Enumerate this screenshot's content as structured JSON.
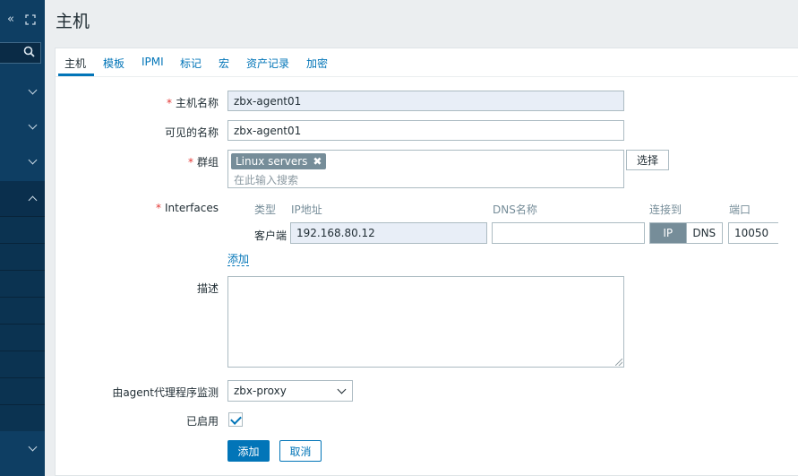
{
  "sidebar": {
    "collapse_icon": "double-chevron-left-icon",
    "expand_icon": "expand-icon",
    "search_icon": "search-icon",
    "sections": [
      "collapsed",
      "collapsed",
      "collapsed",
      "expanded",
      "collapsed"
    ]
  },
  "header": {
    "title": "主机"
  },
  "tabs": [
    {
      "label": "主机",
      "active": true
    },
    {
      "label": "模板"
    },
    {
      "label": "IPMI"
    },
    {
      "label": "标记"
    },
    {
      "label": "宏"
    },
    {
      "label": "资产记录"
    },
    {
      "label": "加密"
    }
  ],
  "form": {
    "host_name": {
      "label": "主机名称",
      "required": true,
      "value": "zbx-agent01"
    },
    "visible_name": {
      "label": "可见的名称",
      "value": "zbx-agent01"
    },
    "groups": {
      "label": "群组",
      "required": true,
      "chips": [
        "Linux servers"
      ],
      "placeholder": "在此输入搜索",
      "select_button": "选择"
    },
    "interfaces": {
      "label": "Interfaces",
      "required": true,
      "headers": {
        "type": "类型",
        "ip": "IP地址",
        "dns": "DNS名称",
        "connect": "连接到",
        "port": "端口"
      },
      "rows": [
        {
          "type": "客户端",
          "ip": "192.168.80.12",
          "dns": "",
          "connect_ip": "IP",
          "connect_dns": "DNS",
          "port": "10050"
        }
      ],
      "add_link": "添加"
    },
    "description": {
      "label": "描述",
      "value": ""
    },
    "monitored_by_proxy": {
      "label": "由agent代理程序监测",
      "value": "zbx-proxy"
    },
    "enabled": {
      "label": "已启用",
      "checked": true
    },
    "buttons": {
      "add": "添加",
      "cancel": "取消"
    }
  },
  "colors": {
    "accent": "#0275b8",
    "sidebar": "#0e3e63",
    "required": "#e33734",
    "chip": "#768d99"
  }
}
